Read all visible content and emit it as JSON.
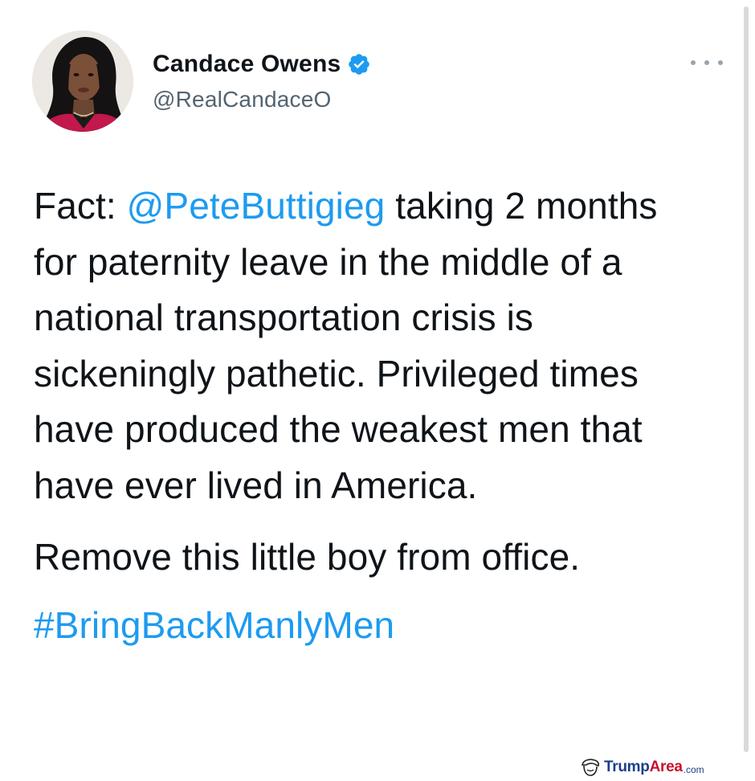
{
  "tweet": {
    "author": {
      "display_name": "Candace Owens",
      "handle": "@RealCandaceO",
      "verified": true,
      "verified_icon": "verified-badge-icon",
      "avatar": "profile-photo"
    },
    "more_icon": "more-options-icon",
    "body": {
      "paragraph1_prefix": "Fact: ",
      "mention": "@PeteButtigieg",
      "paragraph1_suffix": " taking 2 months for paternity leave in the middle of a national transportation crisis is sickeningly pathetic. Privileged times have produced the weakest men that have ever lived in America.",
      "paragraph2": "Remove this little boy from office.",
      "hashtag": "#BringBackManlyMen"
    }
  },
  "watermark": {
    "icon": "trump-hair-logo-icon",
    "brand_part1": "Trump",
    "brand_part2": "Area",
    "brand_suffix": ".com"
  },
  "colors": {
    "link": "#1d9bf0",
    "text": "#0f1419",
    "secondary_text": "#536471",
    "verified": "#1d9bf0",
    "watermark_blue": "#1d3f8a",
    "watermark_red": "#c8102e"
  }
}
